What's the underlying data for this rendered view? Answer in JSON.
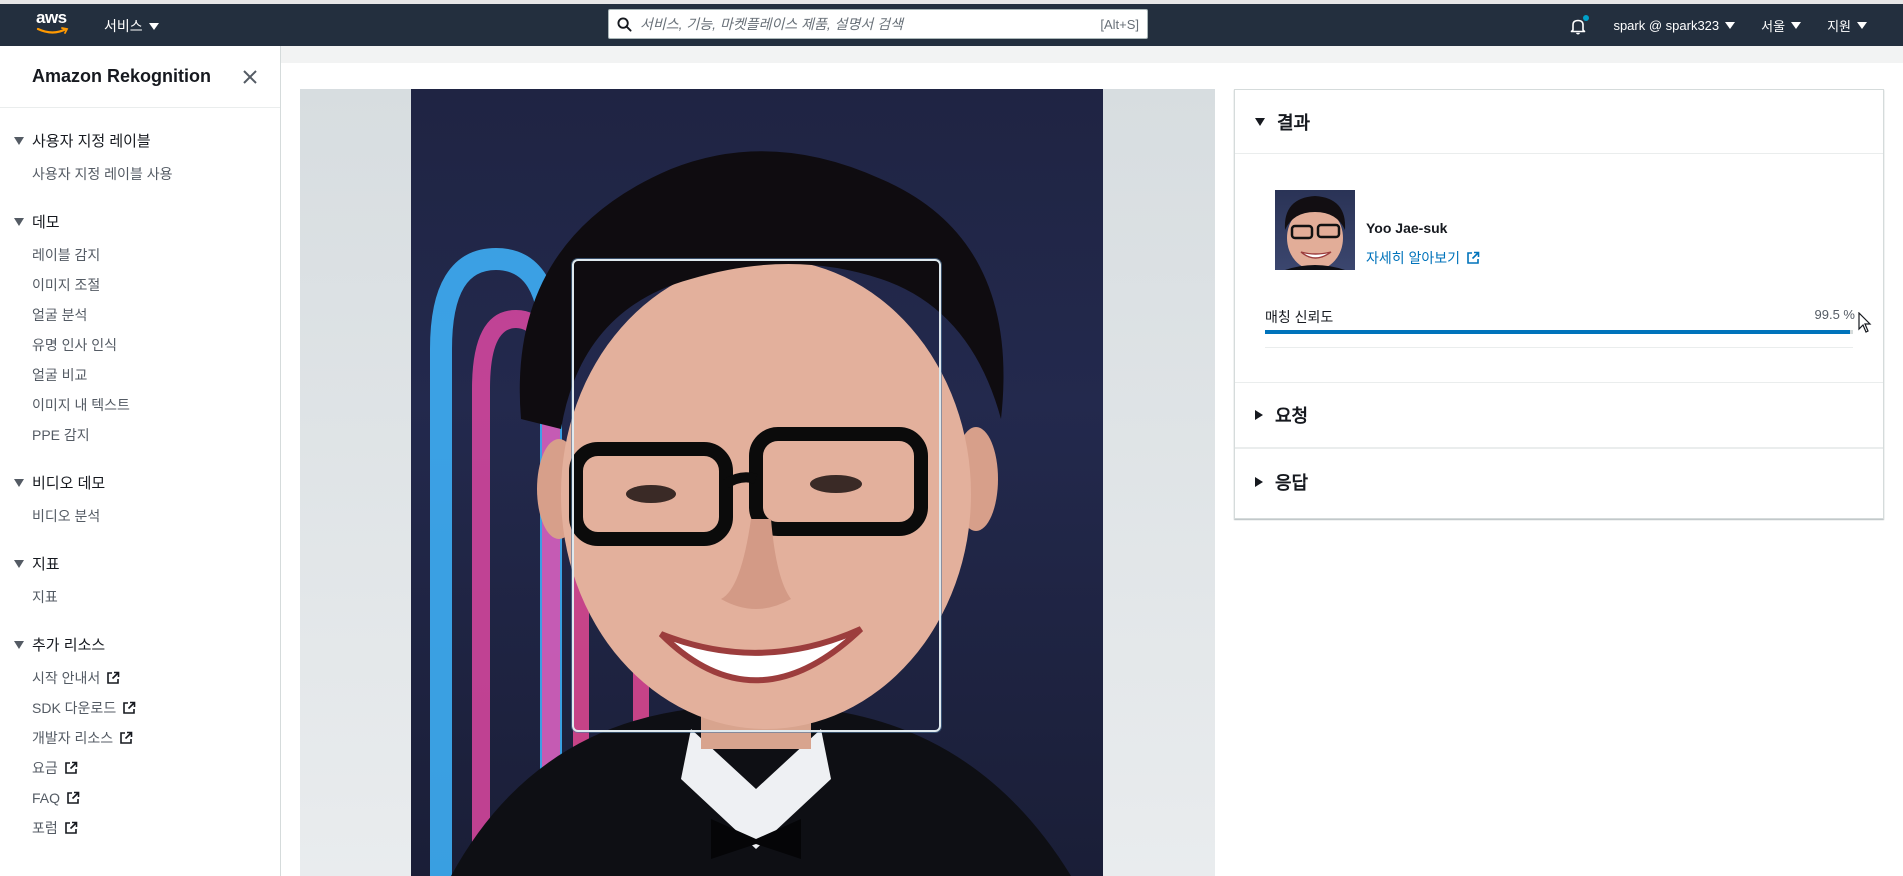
{
  "topnav": {
    "logo_text": "aws",
    "services_label": "서비스",
    "search_placeholder": "서비스, 기능, 마켓플레이스 제품, 설명서 검색",
    "search_shortcut": "[Alt+S]",
    "account_label": "spark @ spark323",
    "region_label": "서울",
    "support_label": "지원"
  },
  "sidebar": {
    "title": "Amazon Rekognition",
    "sections": [
      {
        "label": "사용자 지정 레이블",
        "items": [
          {
            "label": "사용자 지정 레이블 사용"
          }
        ]
      },
      {
        "label": "데모",
        "items": [
          {
            "label": "레이블 감지"
          },
          {
            "label": "이미지 조절"
          },
          {
            "label": "얼굴 분석"
          },
          {
            "label": "유명 인사 인식"
          },
          {
            "label": "얼굴 비교"
          },
          {
            "label": "이미지 내 텍스트"
          },
          {
            "label": "PPE 감지"
          }
        ]
      },
      {
        "label": "비디오 데모",
        "items": [
          {
            "label": "비디오 분석"
          }
        ]
      },
      {
        "label": "지표",
        "items": [
          {
            "label": "지표"
          }
        ]
      },
      {
        "label": "추가 리소스",
        "items": [
          {
            "label": "시작 안내서",
            "external": true
          },
          {
            "label": "SDK 다운로드",
            "external": true
          },
          {
            "label": "개발자 리소스",
            "external": true
          },
          {
            "label": "요금",
            "external": true
          },
          {
            "label": "FAQ",
            "external": true
          },
          {
            "label": "포럼",
            "external": true
          }
        ]
      }
    ]
  },
  "results": {
    "title": "결과",
    "celebrity_name": "Yoo Jae-suk",
    "learn_more": "자세히 알아보기",
    "confidence_label": "매칭 신뢰도",
    "confidence_value": "99.5 %",
    "confidence_fraction": 0.995,
    "request_label": "요청",
    "response_label": "응답"
  },
  "colors": {
    "nav_bg": "#232f3e",
    "link": "#0073bb",
    "progress": "#0073bb"
  }
}
